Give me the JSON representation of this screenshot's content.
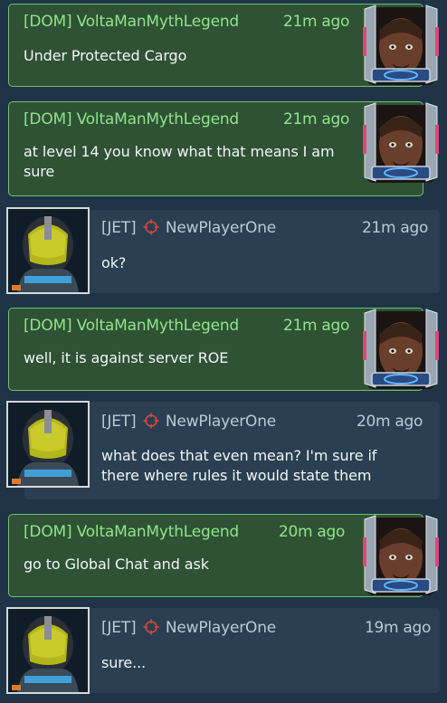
{
  "messages": [
    {
      "kind": "own",
      "alliance": "[DOM]",
      "name": "VoltaManMythLegend",
      "time": "21m ago",
      "text": "Under Protected Cargo"
    },
    {
      "kind": "own",
      "alliance": "[DOM]",
      "name": "VoltaManMythLegend",
      "time": "21m ago",
      "text": "at level 14 you know what that means I am sure"
    },
    {
      "kind": "other",
      "alliance": "[JET]",
      "name": "NewPlayerOne",
      "time": "21m ago",
      "text": "ok?"
    },
    {
      "kind": "own",
      "alliance": "[DOM]",
      "name": "VoltaManMythLegend",
      "time": "21m ago",
      "text": "well, it is against server ROE"
    },
    {
      "kind": "other",
      "alliance": "[JET]",
      "name": "NewPlayerOne",
      "time": "20m ago",
      "text": "what does that even mean? I'm sure if there where rules it would state them"
    },
    {
      "kind": "own",
      "alliance": "[DOM]",
      "name": "VoltaManMythLegend",
      "time": "20m ago",
      "text": "go to Global Chat and ask"
    },
    {
      "kind": "other",
      "alliance": "[JET]",
      "name": "NewPlayerOne",
      "time": "19m ago",
      "text": "sure..."
    }
  ],
  "icons": {
    "target": "crosshair-icon",
    "own_avatar": "klingon-portrait",
    "other_avatar": "helmet-pilot-portrait"
  },
  "colors": {
    "background": "#1f3446",
    "own_bubble": "#2f5234",
    "own_border": "#6fbf73",
    "own_name": "#8fe58a",
    "other_bubble": "#2a4052",
    "other_text": "#b9cad6",
    "target_red": "#e0423c"
  }
}
